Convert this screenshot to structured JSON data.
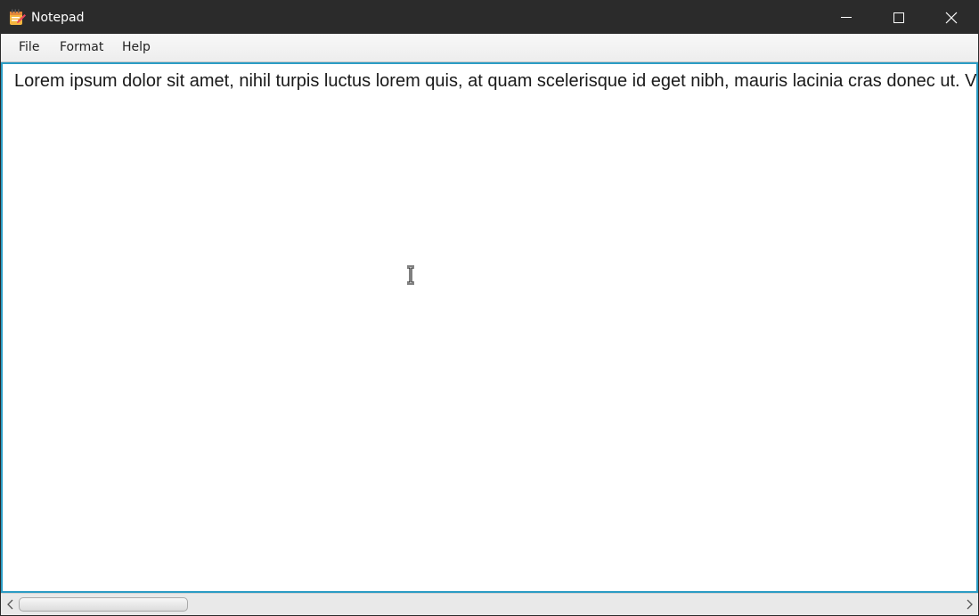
{
  "window": {
    "title": "Notepad",
    "controls": {
      "minimize": "minimize-icon",
      "maximize": "maximize-icon",
      "close": "close-icon"
    }
  },
  "menu": {
    "file": "File",
    "format": "Format",
    "help": "Help"
  },
  "editor": {
    "text": "Lorem ipsum dolor sit amet, nihil turpis luctus lorem quis, at quam scelerisque id eget nibh, mauris lacinia cras donec ut. V"
  },
  "colors": {
    "titlebar": "#2b2b2b",
    "editor_focus_border": "#2b9cc4",
    "menubar": "#f0f0f0"
  },
  "scrollbar": {
    "horizontal_position": 0
  }
}
